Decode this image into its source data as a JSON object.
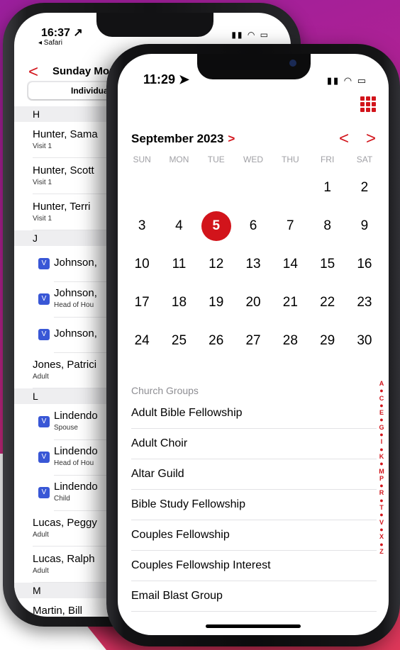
{
  "back_phone": {
    "time": "16:37 ↗",
    "safari": "◂ Safari",
    "status_icons": "▮▮ ◠ ▭",
    "back_chevron": "<",
    "title": "Sunday Morn",
    "segment": "Individuals (",
    "sections": [
      {
        "letter": "H",
        "rows": [
          {
            "name": "Hunter, Sama",
            "sub": "Visit 1",
            "check": false
          },
          {
            "name": "Hunter, Scott",
            "sub": "Visit 1",
            "check": false
          },
          {
            "name": "Hunter, Terri",
            "sub": "Visit 1",
            "check": false
          }
        ]
      },
      {
        "letter": "J",
        "rows": [
          {
            "name": "Johnson,",
            "sub": "",
            "check": true
          },
          {
            "name": "Johnson,",
            "sub": "Head of Hou",
            "check": true
          },
          {
            "name": "Johnson,",
            "sub": "",
            "check": true
          },
          {
            "name": "Jones, Patrici",
            "sub": "Adult",
            "check": false
          }
        ]
      },
      {
        "letter": "L",
        "rows": [
          {
            "name": "Lindendo",
            "sub": "Spouse",
            "check": true
          },
          {
            "name": "Lindendo",
            "sub": "Head of Hou",
            "check": true
          },
          {
            "name": "Lindendo",
            "sub": "Child",
            "check": true
          },
          {
            "name": "Lucas, Peggy",
            "sub": "Adult",
            "check": false
          },
          {
            "name": "Lucas, Ralph",
            "sub": "Adult",
            "check": false
          }
        ]
      },
      {
        "letter": "M",
        "rows": [
          {
            "name": "Martin, Bill",
            "sub": "",
            "check": false
          }
        ]
      }
    ]
  },
  "front_phone": {
    "time": "11:29 ➤",
    "status_icons": "▮▮ ◠ ▭",
    "month_label": "September 2023",
    "month_chevron": ">",
    "prev": "<",
    "next": ">",
    "weekdays": [
      "SUN",
      "MON",
      "TUE",
      "WED",
      "THU",
      "FRI",
      "SAT"
    ],
    "days": [
      "",
      "",
      "",
      "",
      "",
      "1",
      "2",
      "3",
      "4",
      "5",
      "6",
      "7",
      "8",
      "9",
      "10",
      "11",
      "12",
      "13",
      "14",
      "15",
      "16",
      "17",
      "18",
      "19",
      "20",
      "21",
      "22",
      "23",
      "24",
      "25",
      "26",
      "27",
      "28",
      "29",
      "30"
    ],
    "selected_day": "5",
    "groups_header": "Church Groups",
    "groups": [
      "Adult Bible Fellowship",
      "Adult Choir",
      "Altar Guild",
      "Bible Study Fellowship",
      "Couples Fellowship",
      "Couples Fellowship Interest",
      "Email Blast Group"
    ],
    "index_letters": [
      "A",
      "●",
      "C",
      "●",
      "E",
      "●",
      "G",
      "●",
      "I",
      "●",
      "K",
      "●",
      "M",
      "P",
      "●",
      "R",
      "●",
      "T",
      "●",
      "V",
      "●",
      "X",
      "●",
      "Z"
    ]
  },
  "colors": {
    "accent": "#d2141b",
    "check": "#3957d6"
  }
}
